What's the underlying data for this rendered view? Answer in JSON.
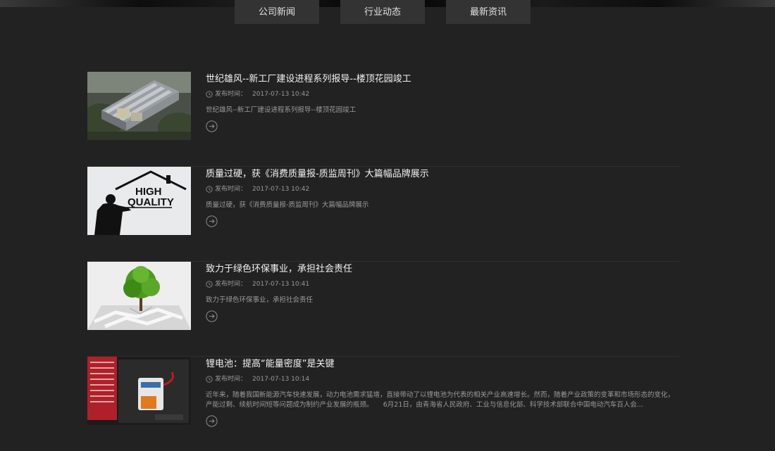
{
  "tabs": [
    {
      "label": "公司新闻"
    },
    {
      "label": "行业动态"
    },
    {
      "label": "最新资讯"
    }
  ],
  "news": [
    {
      "title": "世纪雄风--新工厂建设进程系列报导--楼顶花园竣工",
      "time_label": "发布时间：",
      "date": "2017-07-13 10:42",
      "summary": "世纪雄风--新工厂建设进程系列报导--楼顶花园竣工",
      "image": "factory-rooftop-image"
    },
    {
      "title": "质量过硬，获《消费质量报-质监周刊》大篇幅品牌展示",
      "time_label": "发布时间：",
      "date": "2017-07-13 10:42",
      "summary": "质量过硬，获《消费质量报-质监周刊》大篇幅品牌展示",
      "image": "high-quality-image",
      "image_text": [
        "HIGH",
        "QUALITY"
      ]
    },
    {
      "title": "致力于绿色环保事业，承担社会责任",
      "time_label": "发布时间：",
      "date": "2017-07-13 10:41",
      "summary": "致力于绿色环保事业，承担社会责任",
      "image": "green-tree-image"
    },
    {
      "title": "锂电池：提高“能量密度”是关键",
      "time_label": "发布时间：",
      "date": "2017-07-13 10:14",
      "summary": "近年来，随着我国新能源汽车快速发展，动力电池需求猛增，直接带动了以锂电池为代表的相关产业高速增长。然而，随着产业政策的变革和市场形态的变化，产能过剩、续航时间短等问题成为制约产业发展的瓶颈。　　6月21日，由青海省人民政府、工业与信息化部、科学技术部联合中国电动汽车百人会...",
      "image": "lithium-battery-image"
    }
  ]
}
